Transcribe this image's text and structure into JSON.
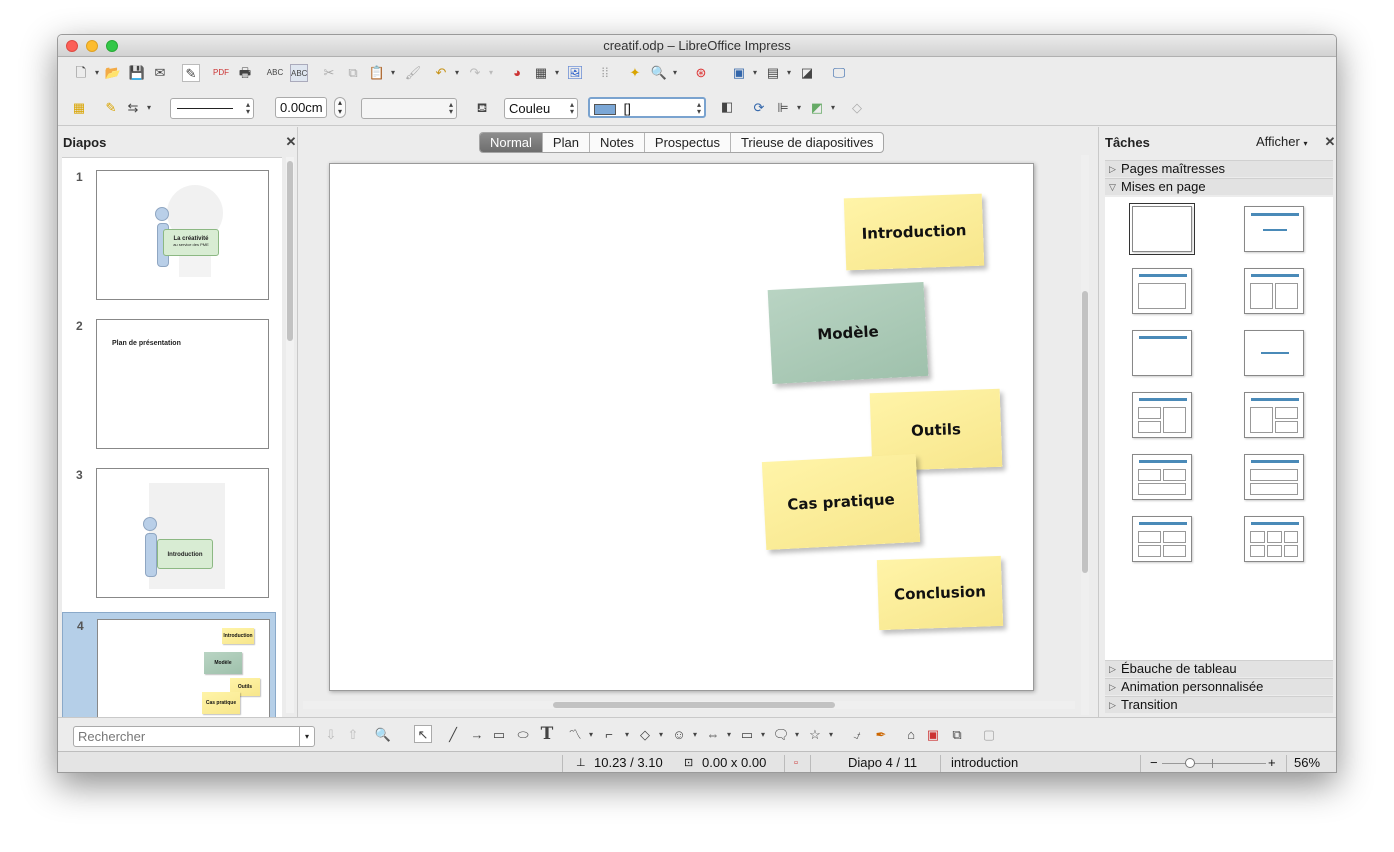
{
  "window": {
    "title": "creatif.odp – LibreOffice Impress"
  },
  "formatting": {
    "line_width": "0.00cm",
    "color_mode": "Couleu",
    "fill_color_value": "[]"
  },
  "slides_panel": {
    "title": "Diapos",
    "slides": [
      {
        "num": "1",
        "title_text": "La créativité",
        "subtitle_text": "au service des PME"
      },
      {
        "num": "2",
        "title_text": "Plan de présentation"
      },
      {
        "num": "3",
        "title_text": "Introduction"
      },
      {
        "num": "4",
        "notes": [
          "Introduction",
          "Modèle",
          "Outils",
          "Cas pratique"
        ]
      }
    ]
  },
  "view_tabs": [
    "Normal",
    "Plan",
    "Notes",
    "Prospectus",
    "Trieuse de diapositives"
  ],
  "active_view_tab": "Normal",
  "slide": {
    "notes": [
      {
        "label": "Introduction",
        "color": "#f7e68c"
      },
      {
        "label": "Modèle",
        "color": "#a8c8b4"
      },
      {
        "label": "Outils",
        "color": "#f7e68c"
      },
      {
        "label": "Cas pratique",
        "color": "#f7e68c"
      },
      {
        "label": "Conclusion",
        "color": "#f7e68c"
      }
    ]
  },
  "tasks_panel": {
    "title": "Tâches",
    "view_menu": "Afficher",
    "sections": {
      "master_pages": "Pages maîtresses",
      "layouts": "Mises en page",
      "table_design": "Ébauche de tableau",
      "custom_animation": "Animation personnalisée",
      "transition": "Transition"
    }
  },
  "search": {
    "placeholder": "Rechercher"
  },
  "status": {
    "position": "10.23 / 3.10",
    "size": "0.00 x 0.00",
    "slide_indicator": "Diapo 4 / 11",
    "master_name": "introduction",
    "zoom": "56%"
  },
  "colors": {
    "accent_blue": "#4a8ab8",
    "selection": "#b5cfe8",
    "note_yellow": "#f7e68c",
    "note_green": "#a8c8b4"
  }
}
